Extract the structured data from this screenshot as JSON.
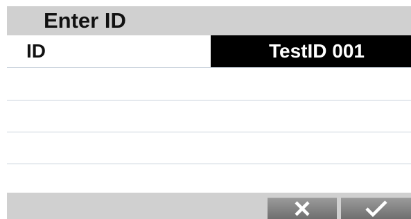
{
  "dialog": {
    "title": "Enter ID"
  },
  "fields": [
    {
      "label": "ID",
      "value": "TestID 001"
    }
  ],
  "footer": {
    "cancel_icon": "close-icon",
    "confirm_icon": "checkmark-icon"
  },
  "colors": {
    "header_bg": "#d0d0d0",
    "value_bg": "#000000",
    "value_text": "#ffffff",
    "button_bg": "#808080",
    "row_divider": "#c9d2dc"
  }
}
